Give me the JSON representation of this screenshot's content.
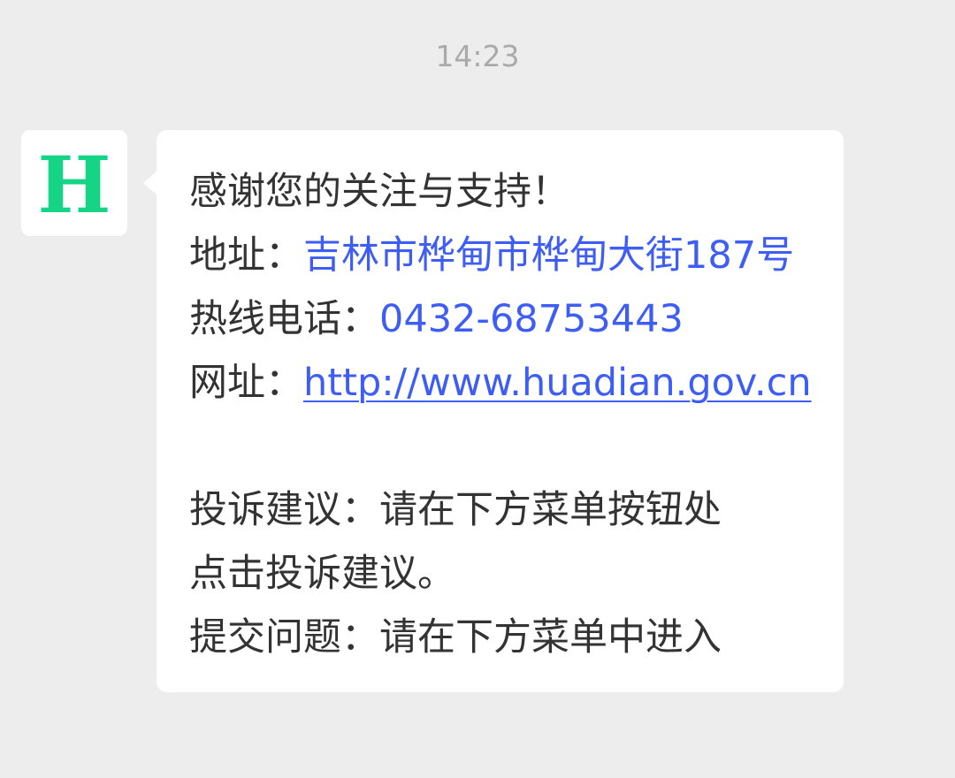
{
  "timestamp": "14:23",
  "account": {
    "avatar_letter": "H",
    "avatar_color": "#16d486"
  },
  "message": {
    "greeting": "感谢您的关注与支持！",
    "address_label": "地址：",
    "address_value": "吉林市桦甸市桦甸大街187号",
    "hotline_label": "热线电话：",
    "hotline_value": "0432-68753443",
    "website_label": "网址：",
    "website_value": "http://www.huadian.gov.cn",
    "complaint_line1": "投诉建议：请在下方菜单按钮处",
    "complaint_line2": "点击投诉建议。",
    "question_line": "提交问题：请在下方菜单中进入"
  },
  "colors": {
    "background": "#ededed",
    "bubble": "#ffffff",
    "link": "#3d5df5",
    "text": "#333333",
    "timestamp": "#aaaaaa"
  }
}
